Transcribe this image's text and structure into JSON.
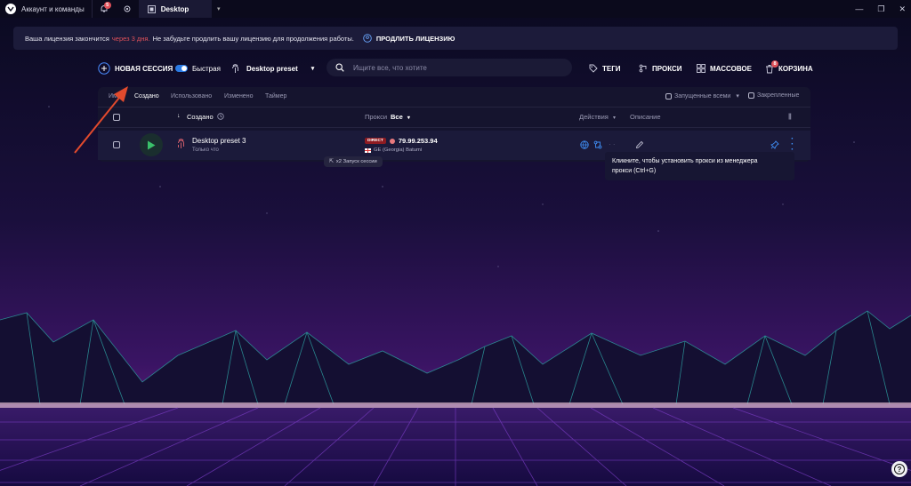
{
  "titlebar": {
    "account_label": "Аккаунт и команды",
    "notifications_count": "5",
    "tab_label": "Desktop",
    "window_controls": [
      "minimize-icon",
      "restore-icon",
      "close-icon"
    ]
  },
  "banner": {
    "text_before": "Ваша лицензия закончится",
    "warning": "через 3 дня.",
    "text_after": "Не забудьте продлить вашу лицензию для продолжения работы.",
    "renew_label": "ПРОДЛИТЬ ЛИЦЕНЗИЮ"
  },
  "toolbar": {
    "new_session_label": "НОВАЯ СЕССИЯ",
    "quick_label": "Быстрая",
    "preset_label": "Desktop preset",
    "search_placeholder": "Ищите все, что хотите",
    "tags_label": "ТЕГИ",
    "proxy_label": "ПРОКСИ",
    "bulk_label": "МАССОВОЕ",
    "trash_label": "КОРЗИНА",
    "trash_count": "8"
  },
  "sort_tabs": [
    "Имя",
    "Создано",
    "Использовано",
    "Изменено",
    "Таймер"
  ],
  "active_sort": "Создано",
  "filters": {
    "running_label": "Запущенные всеми",
    "pinned_label": "Закрепленные"
  },
  "table": {
    "created_label": "Создано",
    "proxy_label": "Прокси",
    "proxy_filter": "Все",
    "actions_label": "Действия",
    "description_label": "Описание"
  },
  "session": {
    "name": "Desktop preset 3",
    "subtitle": "Только что",
    "proxy_type": "DIRECT",
    "ip": "79.99.253.94",
    "location": "GE (Georgia) Batumi",
    "launches": "x2 Запуск сессии"
  },
  "tooltip": {
    "line1": "Кликните, чтобы установить прокси из менеджера",
    "line2": "прокси (Ctrl+G)"
  },
  "colors": {
    "accent_blue": "#2b7be4",
    "warning_red": "#e0515a",
    "banner_bg": "#1c1b3a",
    "panel_bg": "#15142e",
    "arrow_red": "#e24a2d"
  }
}
